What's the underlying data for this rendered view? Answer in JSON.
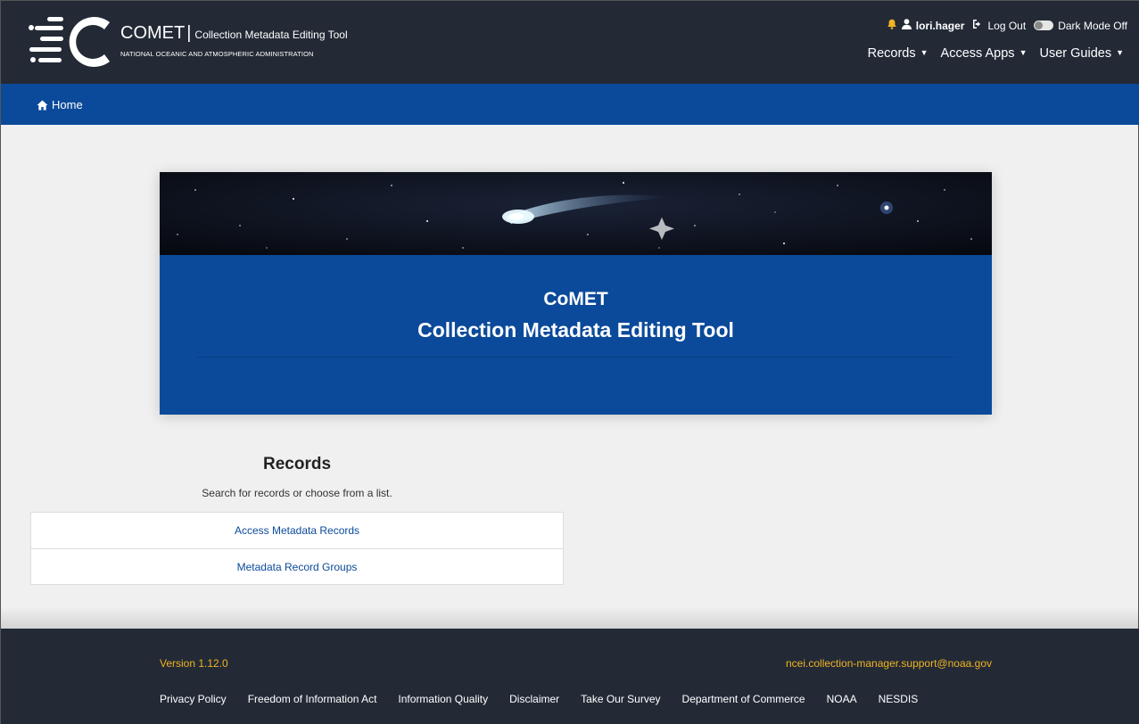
{
  "header": {
    "brand_name": "COMET",
    "brand_separator": "|",
    "brand_subtitle": "Collection Metadata Editing Tool",
    "organization": "NATIONAL OCEANIC AND ATMOSPHERIC ADMINISTRATION",
    "notification_icon": "bell-icon",
    "user_icon": "user-icon",
    "username": "lori.hager",
    "logout_icon": "sign-out-icon",
    "logout_label": "Log Out",
    "dark_mode_label": "Dark Mode Off",
    "dark_mode_on": false,
    "nav": {
      "records": "Records",
      "access_apps": "Access Apps",
      "user_guides": "User Guides"
    }
  },
  "breadcrumb": {
    "icon": "home-icon",
    "home_label": "Home"
  },
  "hero": {
    "title_short": "CoMET",
    "title_long": "Collection Metadata Editing Tool"
  },
  "records": {
    "title": "Records",
    "description": "Search for records or choose from a list.",
    "links": [
      {
        "label": "Access Metadata Records"
      },
      {
        "label": "Metadata Record Groups"
      }
    ]
  },
  "footer": {
    "version": "Version 1.12.0",
    "email": "ncei.collection-manager.support@noaa.gov",
    "links": [
      {
        "label": "Privacy Policy"
      },
      {
        "label": "Freedom of Information Act"
      },
      {
        "label": "Information Quality"
      },
      {
        "label": "Disclaimer"
      },
      {
        "label": "Take Our Survey"
      },
      {
        "label": "Department of Commerce"
      },
      {
        "label": "NOAA"
      },
      {
        "label": "NESDIS"
      }
    ]
  },
  "colors": {
    "header_bg": "#232a36",
    "brand_blue": "#0b4a9a",
    "accent_gold": "#f0b323",
    "page_bg": "#f0f0f0"
  }
}
